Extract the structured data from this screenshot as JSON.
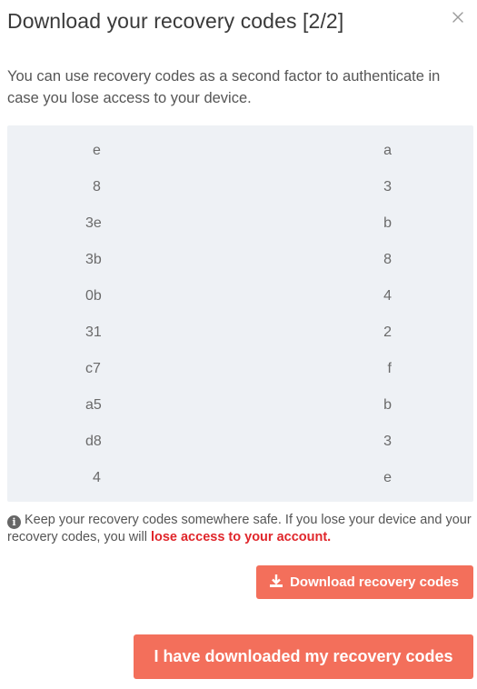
{
  "dialog": {
    "title": "Download your recovery codes [2/2]",
    "close_icon": "close-icon",
    "description": "You can use recovery codes as a second factor to authenticate in case you lose access to your device."
  },
  "codes": [
    {
      "left": "e",
      "right": "a"
    },
    {
      "left": "8",
      "right": "3"
    },
    {
      "left": "3e",
      "right": "b"
    },
    {
      "left": "3b",
      "right": "8"
    },
    {
      "left": "0b",
      "right": "4"
    },
    {
      "left": "31",
      "right": "2"
    },
    {
      "left": "c7",
      "right": "f"
    },
    {
      "left": "a5",
      "right": "b"
    },
    {
      "left": "d8",
      "right": "3"
    },
    {
      "left": "4",
      "right": "e"
    }
  ],
  "notice": {
    "icon": "info-icon",
    "text": "Keep your recovery codes somewhere safe. If you lose your device and your recovery codes, you will ",
    "warning": "lose access to your account."
  },
  "buttons": {
    "download_label": "Download recovery codes",
    "download_icon": "download-icon",
    "confirm_label": "I have downloaded my recovery codes"
  },
  "colors": {
    "accent": "#f36f5b",
    "warning": "#e0262b",
    "codes_background": "#eef1f5"
  }
}
